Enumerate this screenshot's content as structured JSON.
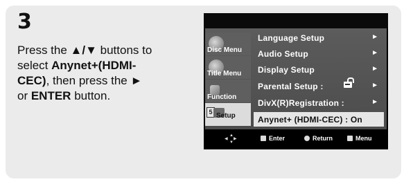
{
  "step": "3",
  "instruction": {
    "line1_pre": "Press the ",
    "arrows": "▲/▼",
    "line1_post": " buttons to",
    "select": "select ",
    "target": "Anynet+(HDMI-",
    "target2": "CEC)",
    "then": ", then press the ",
    "right_arrow": "►",
    "or": "or ",
    "enter": "ENTER",
    "button": " button."
  },
  "osd": {
    "sidebar": [
      {
        "label": "Disc Menu",
        "icon": "disc-icon"
      },
      {
        "label": "Title Menu",
        "icon": "title-icon"
      },
      {
        "label": "Function",
        "icon": "function-icon"
      },
      {
        "label": "Setup",
        "icon": "setup-icon",
        "active": true,
        "badge": "5"
      }
    ],
    "menu": [
      {
        "label": "Language Setup",
        "arrow": "►"
      },
      {
        "label": "Audio Setup",
        "arrow": "►"
      },
      {
        "label": "Display Setup",
        "arrow": "►"
      },
      {
        "label": "Parental Setup :",
        "arrow": "►",
        "icon": "lock-icon"
      },
      {
        "label": "DivX(R)Registration :",
        "arrow": "►"
      },
      {
        "label": "Anynet+ (HDMI-CEC) : On",
        "highlight": true
      }
    ],
    "footer": {
      "enter": "Enter",
      "return": "Return",
      "menu": "Menu"
    }
  }
}
